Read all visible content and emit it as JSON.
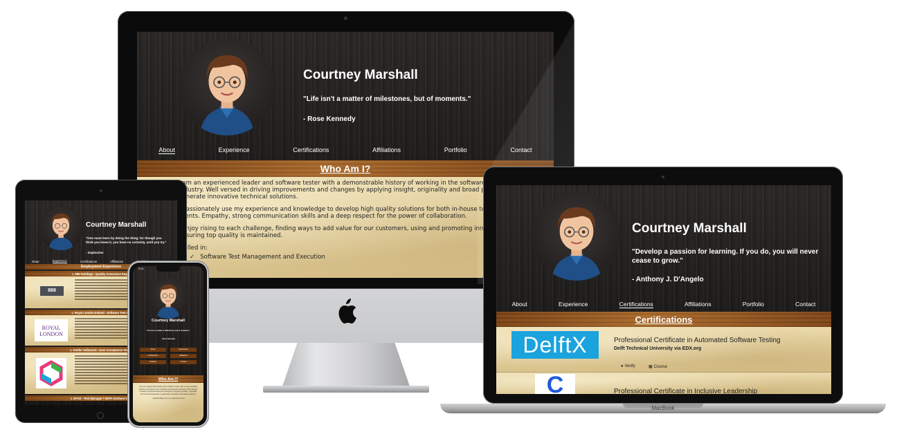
{
  "profile": {
    "name": "Courtney Marshall"
  },
  "nav": [
    "About",
    "Experience",
    "Certifications",
    "Affiliations",
    "Portfolio",
    "Contact"
  ],
  "desktop": {
    "quote": "\"Life isn't a matter of milestones, but of moments.\"",
    "author": "- Rose Kennedy",
    "section_title": "Who Am I?",
    "paragraphs": [
      "I am an experienced leader and software tester with a demonstrable history of working in the software development industry. Well versed in driving improvements and changes by applying insight, originality and broad perspective to generate innovative technical solutions.",
      "I passionately use my experience and knowledge to develop high quality solutions for both in-house teams and external clients. Empathy, strong communication skills and a deep respect for the power of collaboration.",
      "I enjoy rising to each challenge, finding ways to add value for our customers, using and promoting innovative technology ensuring top quality is maintained."
    ],
    "skilled_in_label": "Skilled in:",
    "skill_first": "Software Test Management and Execution"
  },
  "laptop": {
    "quote": "\"Develop a passion for learning. If you do, you will never cease to grow.\"",
    "author": "- Anthony J. D'Angelo",
    "section_title": "Certifications",
    "certs": [
      {
        "logo_text": "DelftX",
        "title": "Professional Certificate in Automated Software Testing",
        "issuer": "Delft Technical University via EDX.org",
        "verify_label": "Verify",
        "course_label": "Course"
      },
      {
        "logo_text": "C",
        "title": "Professional Certificate in Inclusive Leadership"
      }
    ],
    "brand": "MacBook"
  },
  "tablet": {
    "quote": "\"One must learn by doing the thing; for though you think you know it, you have no certainty, until you try.\"",
    "author": "- Sophocles",
    "section_title": "Employment Experience",
    "jobs": [
      {
        "title": "♘ 888 Holdings - Quality Assurance Engi...",
        "logo": "888"
      },
      {
        "title": "♘ Royal London Ireland - Software Test A...",
        "logo_line1": "ROYAL",
        "logo_line2": "LONDON"
      },
      {
        "title": "♘ Dublin Tallaroom - User Acceptance Test ..."
      },
      {
        "title": "♘ DFSS - Test Manager / SEPA Onshore Co..."
      }
    ]
  },
  "phone": {
    "time": "9:41",
    "quote": "\"Life isn't a matter of milestones, but of moments.\"",
    "author": "- Rose Kennedy",
    "section_title": "Who Am I?",
    "paragraphs": [
      "I am an experienced leader and software tester with a demonstrable history of working in the software development industry. Well versed in driving improvements and changes by applying insight, originality and broad perspective to generate innovative technical solutions.",
      "I passionately use my experience and"
    ]
  },
  "colors": {
    "wood_dark": "#1d1b1a",
    "bar_wood": "#8a4f1c",
    "parchment": "#e6d3a3",
    "edx_blue": "#1ba3dd"
  }
}
